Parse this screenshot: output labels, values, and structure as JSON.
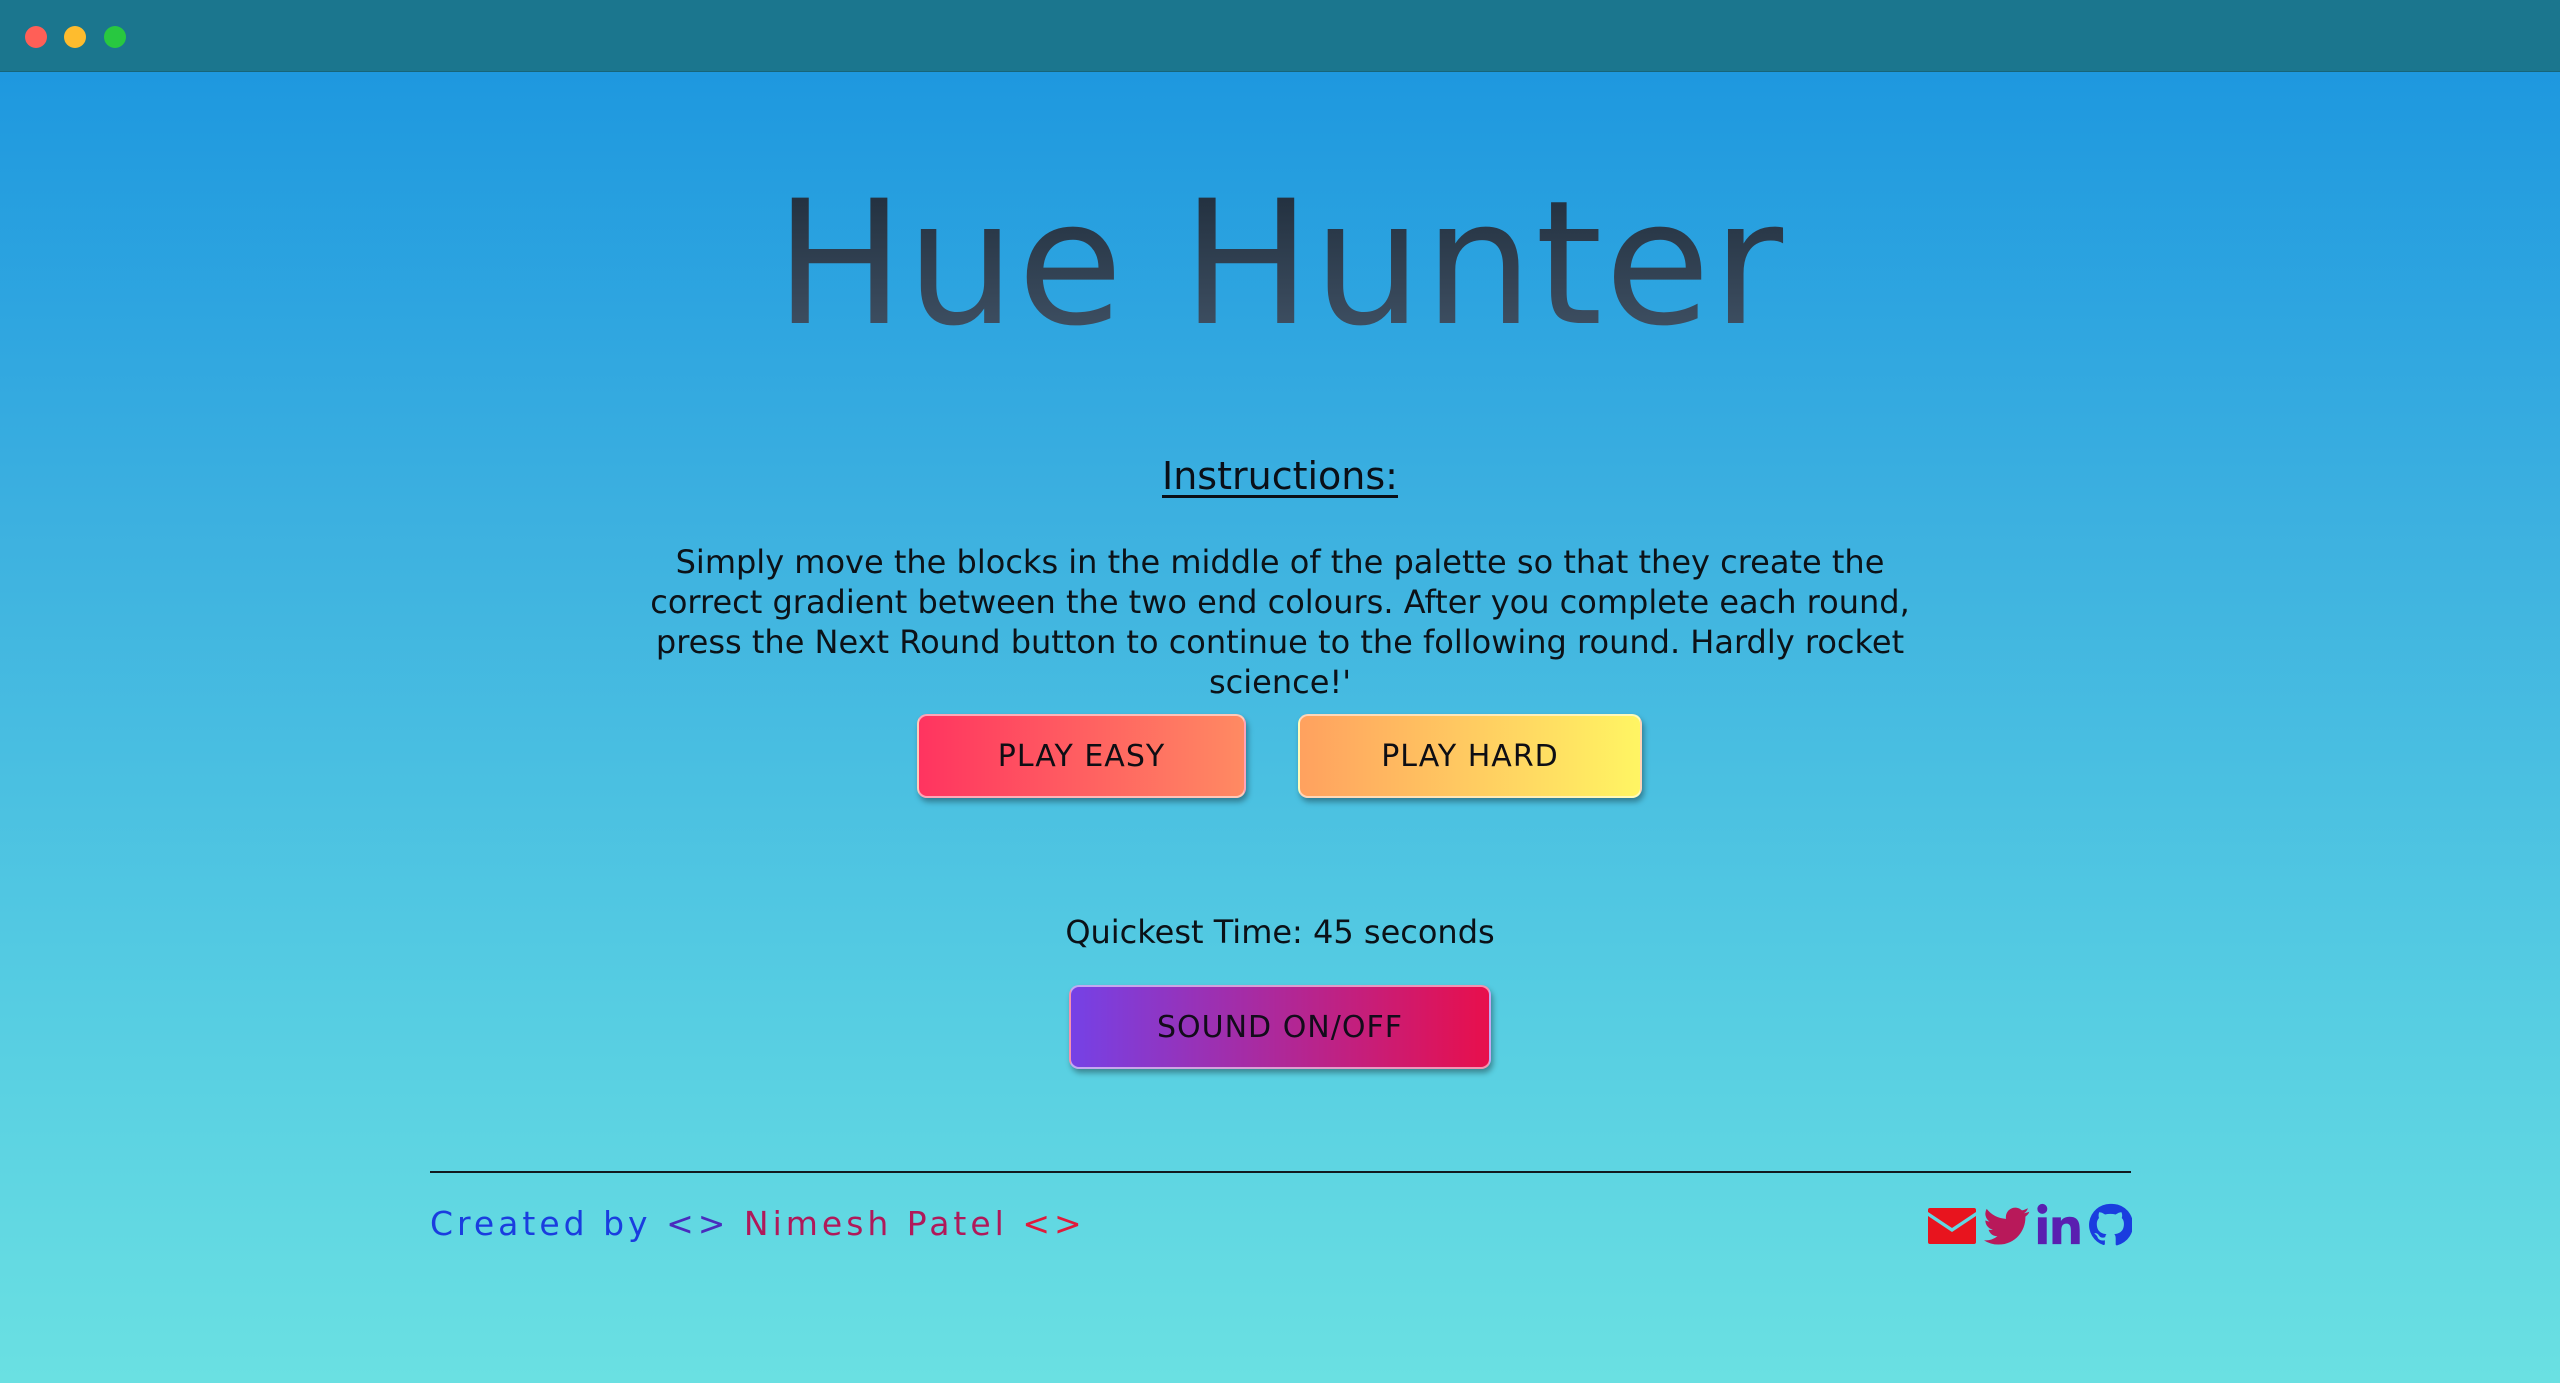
{
  "window": {
    "controls": [
      "close",
      "minimize",
      "maximize"
    ]
  },
  "header": {
    "title": "Hue Hunter"
  },
  "instructions": {
    "heading": "Instructions:",
    "text": "Simply move the blocks in the middle of the palette so that they create the correct gradient between the two end colours. After you complete each round, press the Next Round button to continue to the following round. Hardly rocket science!'"
  },
  "buttons": {
    "play_easy": "PLAY EASY",
    "play_hard": "PLAY HARD",
    "sound": "SOUND ON/OFF"
  },
  "stats": {
    "quickest_time": "Quickest Time: 45 seconds"
  },
  "footer": {
    "created_by": "Created by",
    "symbol_left": "<>",
    "author": "Nimesh Patel",
    "symbol_right": "<>",
    "socials": [
      {
        "icon": "envelope-icon",
        "color": "#e8141e"
      },
      {
        "icon": "twitter-icon",
        "color": "#b8195a"
      },
      {
        "icon": "linkedin-icon",
        "color": "#5a1fb0"
      },
      {
        "icon": "github-icon",
        "color": "#1a3ddf"
      }
    ]
  },
  "colors": {
    "titlebar": "#1b768e",
    "background_top": "#1e98df",
    "background_bottom": "#6ae0e2"
  }
}
